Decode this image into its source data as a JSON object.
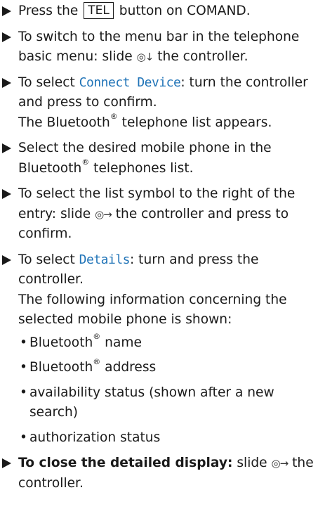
{
  "steps": [
    {
      "pre": "Press the ",
      "key": "TEL",
      "post": " button on COMAND."
    },
    {
      "pre": "To switch to the menu bar in the telephone basic menu: slide ",
      "ctrl": "◎↓",
      "post": " the controller."
    },
    {
      "pre": "To select ",
      "code": "Connect Device",
      "post": ": turn the controller and press to confirm.",
      "result_pre": "The Bluetooth",
      "result_reg": "®",
      "result_post": " telephone list appears."
    },
    {
      "pre": "Select the desired mobile phone in the Bluetooth",
      "reg": "®",
      "post": " telephones list."
    },
    {
      "pre": "To select the list symbol to the right of the entry: slide ",
      "ctrl": "◎→",
      "post": " the controller and press to confirm."
    },
    {
      "pre": "To select ",
      "code": "Details",
      "post": ": turn and press the controller.",
      "result": "The following information concerning the selected mobile phone is shown:"
    },
    {
      "bold": "To close the detailed display:",
      "pre": " slide ",
      "ctrl": "◎→",
      "post": " the controller."
    }
  ],
  "bullets": [
    {
      "pre": "Bluetooth",
      "reg": "®",
      "post": " name"
    },
    {
      "pre": "Bluetooth",
      "reg": "®",
      "post": " address"
    },
    {
      "text": "availability status (shown after a new search)"
    },
    {
      "text": "authorization status"
    }
  ]
}
